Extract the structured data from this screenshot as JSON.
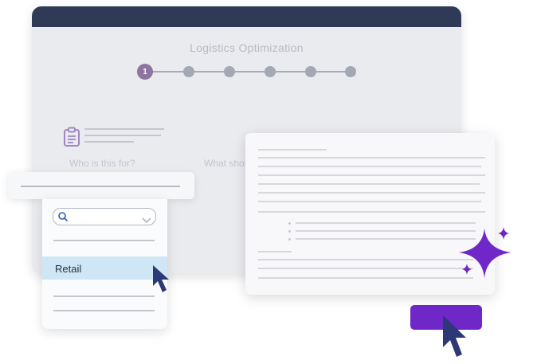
{
  "window": {
    "title": "Logistics Optimization"
  },
  "stepper": {
    "current_step": "1",
    "total_steps": 6
  },
  "form": {
    "question_1": "Who is this for?",
    "question_2": "What should"
  },
  "dropdown": {
    "selected_option": "Retail"
  },
  "icons": {
    "clipboard": "clipboard-icon",
    "search": "search-icon",
    "chevron": "chevron-down-icon",
    "cursor": "mouse-pointer-icon",
    "sparkle": "sparkle-icon"
  },
  "colors": {
    "title_bar": "#2f3a56",
    "accent_purple": "#7027c7",
    "step_active": "#8e759f",
    "selected_row": "#cfe7f5",
    "cursor": "#2d3876"
  }
}
